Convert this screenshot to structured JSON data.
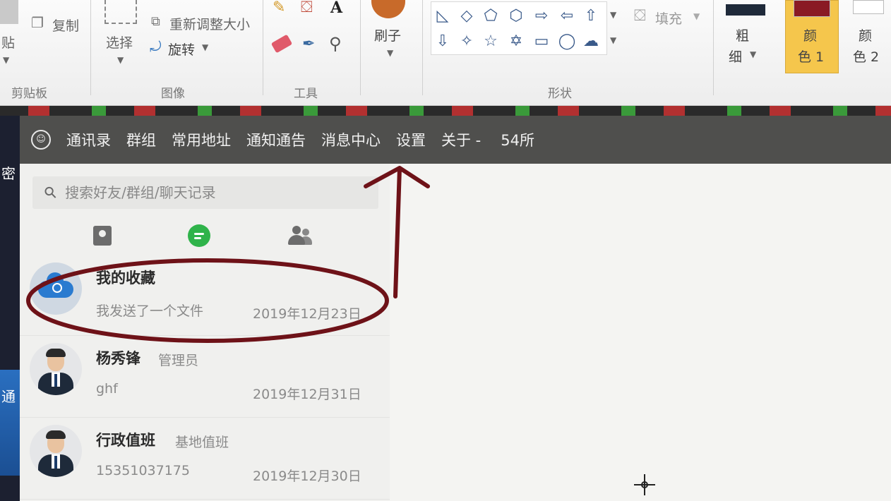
{
  "ribbon": {
    "clipboard": {
      "paste_label": "贴",
      "copy_label": "复制",
      "group_label": "剪贴板"
    },
    "image": {
      "select_label": "选择",
      "resize_label": "重新调整大小",
      "rotate_label": "旋转",
      "group_label": "图像"
    },
    "tools": {
      "group_label": "工具",
      "text_tool_glyph": "A"
    },
    "brush": {
      "label": "刷子"
    },
    "shapes": {
      "group_label": "形状",
      "fill_label": "填充"
    },
    "stroke": {
      "label_line1": "粗",
      "label_line2": "细"
    },
    "color1": {
      "label_line1": "颜",
      "label_line2": "色 1",
      "value": "#8a1a24"
    },
    "color2": {
      "label_line1": "颜",
      "label_line2": "色 2"
    }
  },
  "desktop": {
    "left_top_text": "密",
    "left_bottom_text": "通"
  },
  "app": {
    "nav": [
      "通讯录",
      "群组",
      "常用地址",
      "通知通告",
      "消息中心",
      "设置",
      "关于 -"
    ],
    "user": "54所",
    "search": {
      "placeholder": "搜索好友/群组/聊天记录"
    },
    "chats": [
      {
        "name": "我的收藏",
        "role": "",
        "message": "我发送了一个文件",
        "date": "2019年12月23日"
      },
      {
        "name": "杨秀锋",
        "role": "管理员",
        "message": "ghf",
        "date": "2019年12月31日"
      },
      {
        "name": "行政值班",
        "role": "基地值班",
        "message": "15351037175",
        "date": "2019年12月30日"
      }
    ]
  },
  "colors": {
    "topbar": "#4f4f4d",
    "annotation": "#6e1218",
    "chat_tab_active": "#2fb34a"
  }
}
